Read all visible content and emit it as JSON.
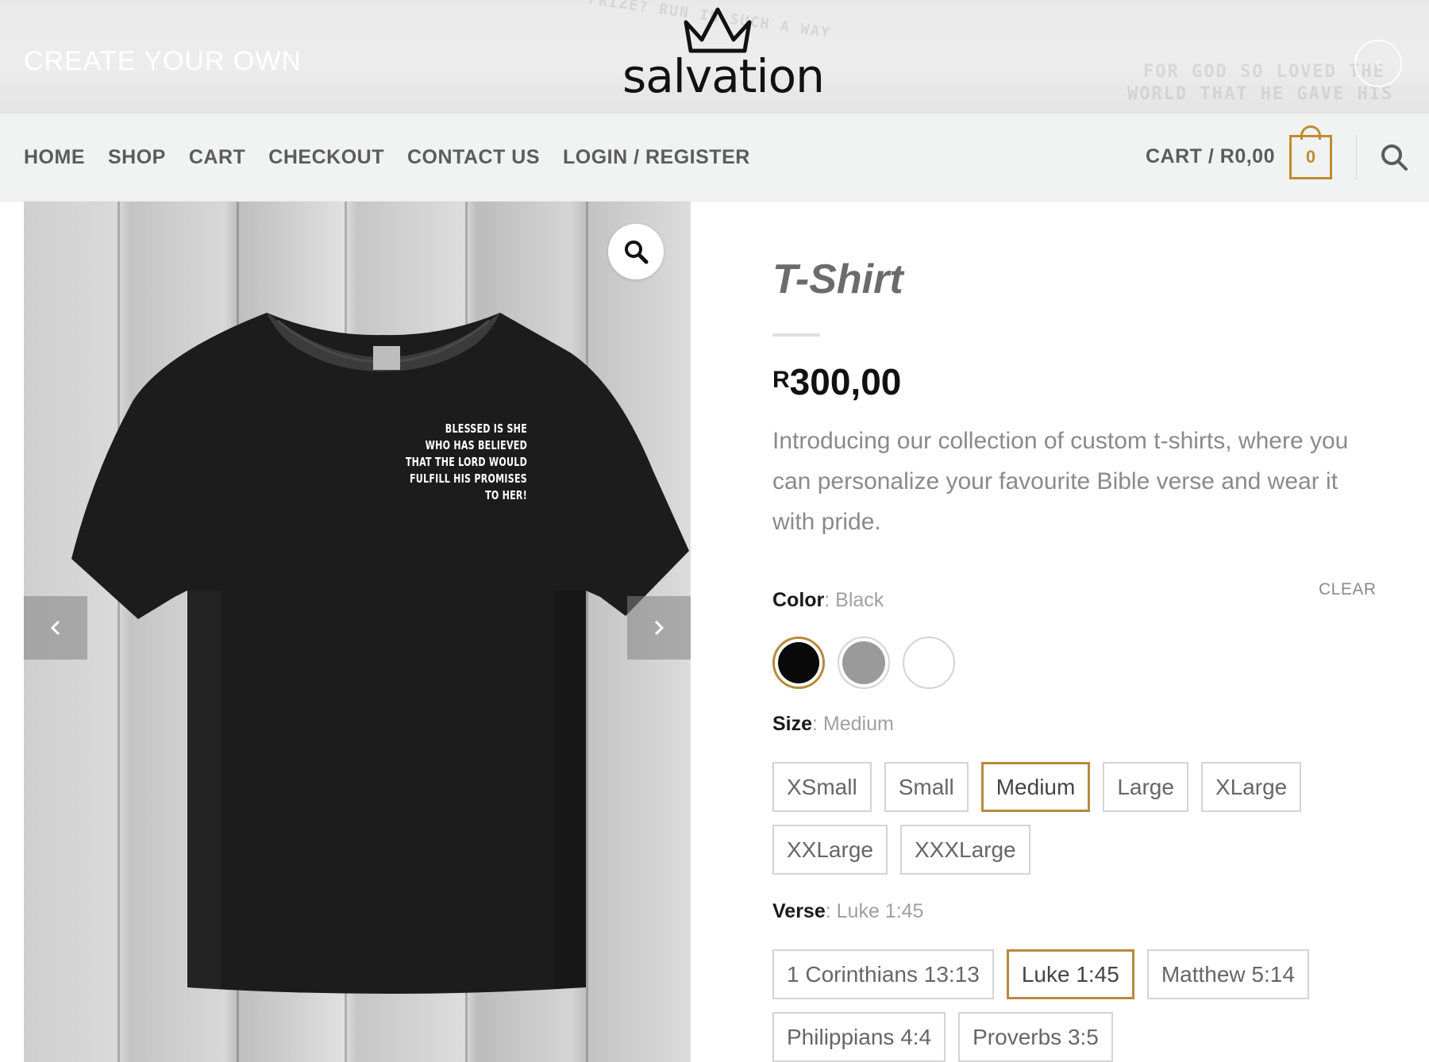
{
  "header": {
    "create_label": "CREATE YOUR OWN",
    "logo_text": "salvation"
  },
  "nav": {
    "links": [
      "HOME",
      "SHOP",
      "CART",
      "CHECKOUT",
      "CONTACT US",
      "LOGIN / REGISTER"
    ],
    "cart_label": "CART / R0,00",
    "cart_count": "0"
  },
  "gallery": {
    "shirt_text": "BLESSED IS SHE WHO HAS BELIEVED THAT THE LORD WOULD FULFILL HIS PROMISES TO HER!",
    "shirt_lines": [
      "BLESSED IS SHE",
      "WHO HAS BELIEVED",
      "THAT THE LORD WOULD",
      "FULFILL HIS PROMISES",
      "TO HER!"
    ]
  },
  "product": {
    "title": "T-Shirt",
    "price_currency": "R",
    "price_amount": "300,00",
    "description": "Introducing our collection of custom t-shirts, where you can personalize your favourite Bible verse and wear it with pride.",
    "clear_label": "CLEAR",
    "color": {
      "label": "Color",
      "value": ": Black",
      "swatches": [
        {
          "name": "Black",
          "hex": "#0a0a0a",
          "selected": true
        },
        {
          "name": "Grey",
          "hex": "#9a9a9a",
          "selected": false
        },
        {
          "name": "White",
          "hex": "#ffffff",
          "selected": false
        }
      ]
    },
    "size": {
      "label": "Size",
      "value": ": Medium",
      "options": [
        "XSmall",
        "Small",
        "Medium",
        "Large",
        "XLarge",
        "XXLarge",
        "XXXLarge"
      ],
      "selected": "Medium"
    },
    "verse": {
      "label": "Verse",
      "value": ": Luke 1:45",
      "options": [
        "1 Corinthians 13:13",
        "Luke 1:45",
        "Matthew 5:14",
        "Philippians 4:4",
        "Proverbs 3:5"
      ],
      "selected": "Luke 1:45"
    }
  },
  "colors": {
    "accent": "#b88a3d",
    "nav_text": "#5c5c5c",
    "nav_bg": "#f1f2f2"
  }
}
